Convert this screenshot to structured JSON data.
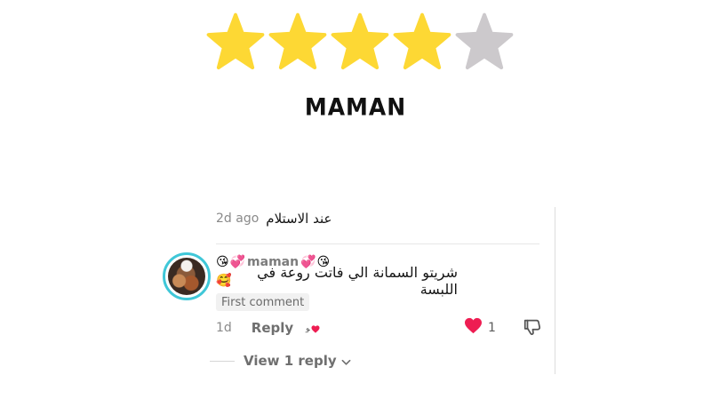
{
  "rating": {
    "value": 4,
    "max": 5,
    "filled_color": "#FDD834",
    "empty_color": "#CCC9CC"
  },
  "reviewer": {
    "title": "MAMAN"
  },
  "previous_comment": {
    "time": "2d ago",
    "text": "عند الاستلام"
  },
  "comment": {
    "username": "maman",
    "username_emojis_left": [
      "😘",
      "💞"
    ],
    "username_emojis_right": [
      "💞",
      "😘"
    ],
    "text": "شريتو السمانة الي فاتت روعة في اللبسة",
    "text_emoji": "🥰",
    "badge": "First comment",
    "time": "1d",
    "reply_label": "Reply",
    "like_count": "1",
    "avatar_ring_color": "#3FC7D8",
    "like_color": "#EE1D52",
    "icons": {
      "like": "heart-icon",
      "dislike": "thumbs-down-icon",
      "creator_liked": "creator-liked-heart-icon"
    }
  },
  "replies": {
    "label": "View 1 reply",
    "icon": "chevron-down-icon"
  }
}
